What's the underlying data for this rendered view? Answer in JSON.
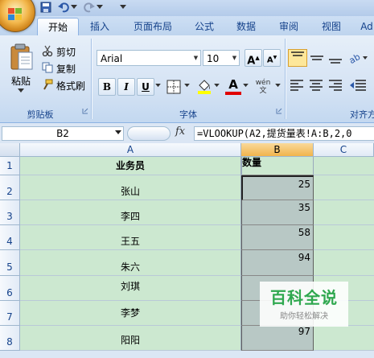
{
  "tabs": [
    "开始",
    "插入",
    "页面布局",
    "公式",
    "数据",
    "审阅",
    "视图",
    "Ad"
  ],
  "clipboard": {
    "paste": "粘贴",
    "cut": "剪切",
    "copy": "复制",
    "format_painter": "格式刷",
    "group_label": "剪贴板"
  },
  "font": {
    "name": "Arial",
    "size": "10",
    "group_label": "字体",
    "bold": "B",
    "italic": "I",
    "underline": "U",
    "grow": "A",
    "shrink": "A",
    "font_color_glyph": "A",
    "phonetic_glyph": "wén 文"
  },
  "alignment": {
    "group_label": "对齐方"
  },
  "name_box": "B2",
  "fx": "fx",
  "formula": "=VLOOKUP(A2,提货量表!A:B,2,0",
  "columns": [
    "A",
    "B",
    "C"
  ],
  "header_row": {
    "num": "1",
    "a": "业务员",
    "b": "数量"
  },
  "rows": [
    {
      "num": "2",
      "name": "张山",
      "qty": "25"
    },
    {
      "num": "3",
      "name": "李四",
      "qty": "35"
    },
    {
      "num": "4",
      "name": "王五",
      "qty": "58"
    },
    {
      "num": "5",
      "name": "朱六",
      "qty": "94"
    },
    {
      "num": "6",
      "name": "刘琪",
      "qty": ""
    },
    {
      "num": "7",
      "name": "李梦",
      "qty": ""
    },
    {
      "num": "8",
      "name": "阳阳",
      "qty": "97"
    }
  ],
  "watermark": {
    "title": "百科全说",
    "subtitle": "助你轻松解决"
  },
  "colors": {
    "accent": "#15428b",
    "cell_green": "#cce8d0",
    "selection": "#b8c8c5"
  }
}
